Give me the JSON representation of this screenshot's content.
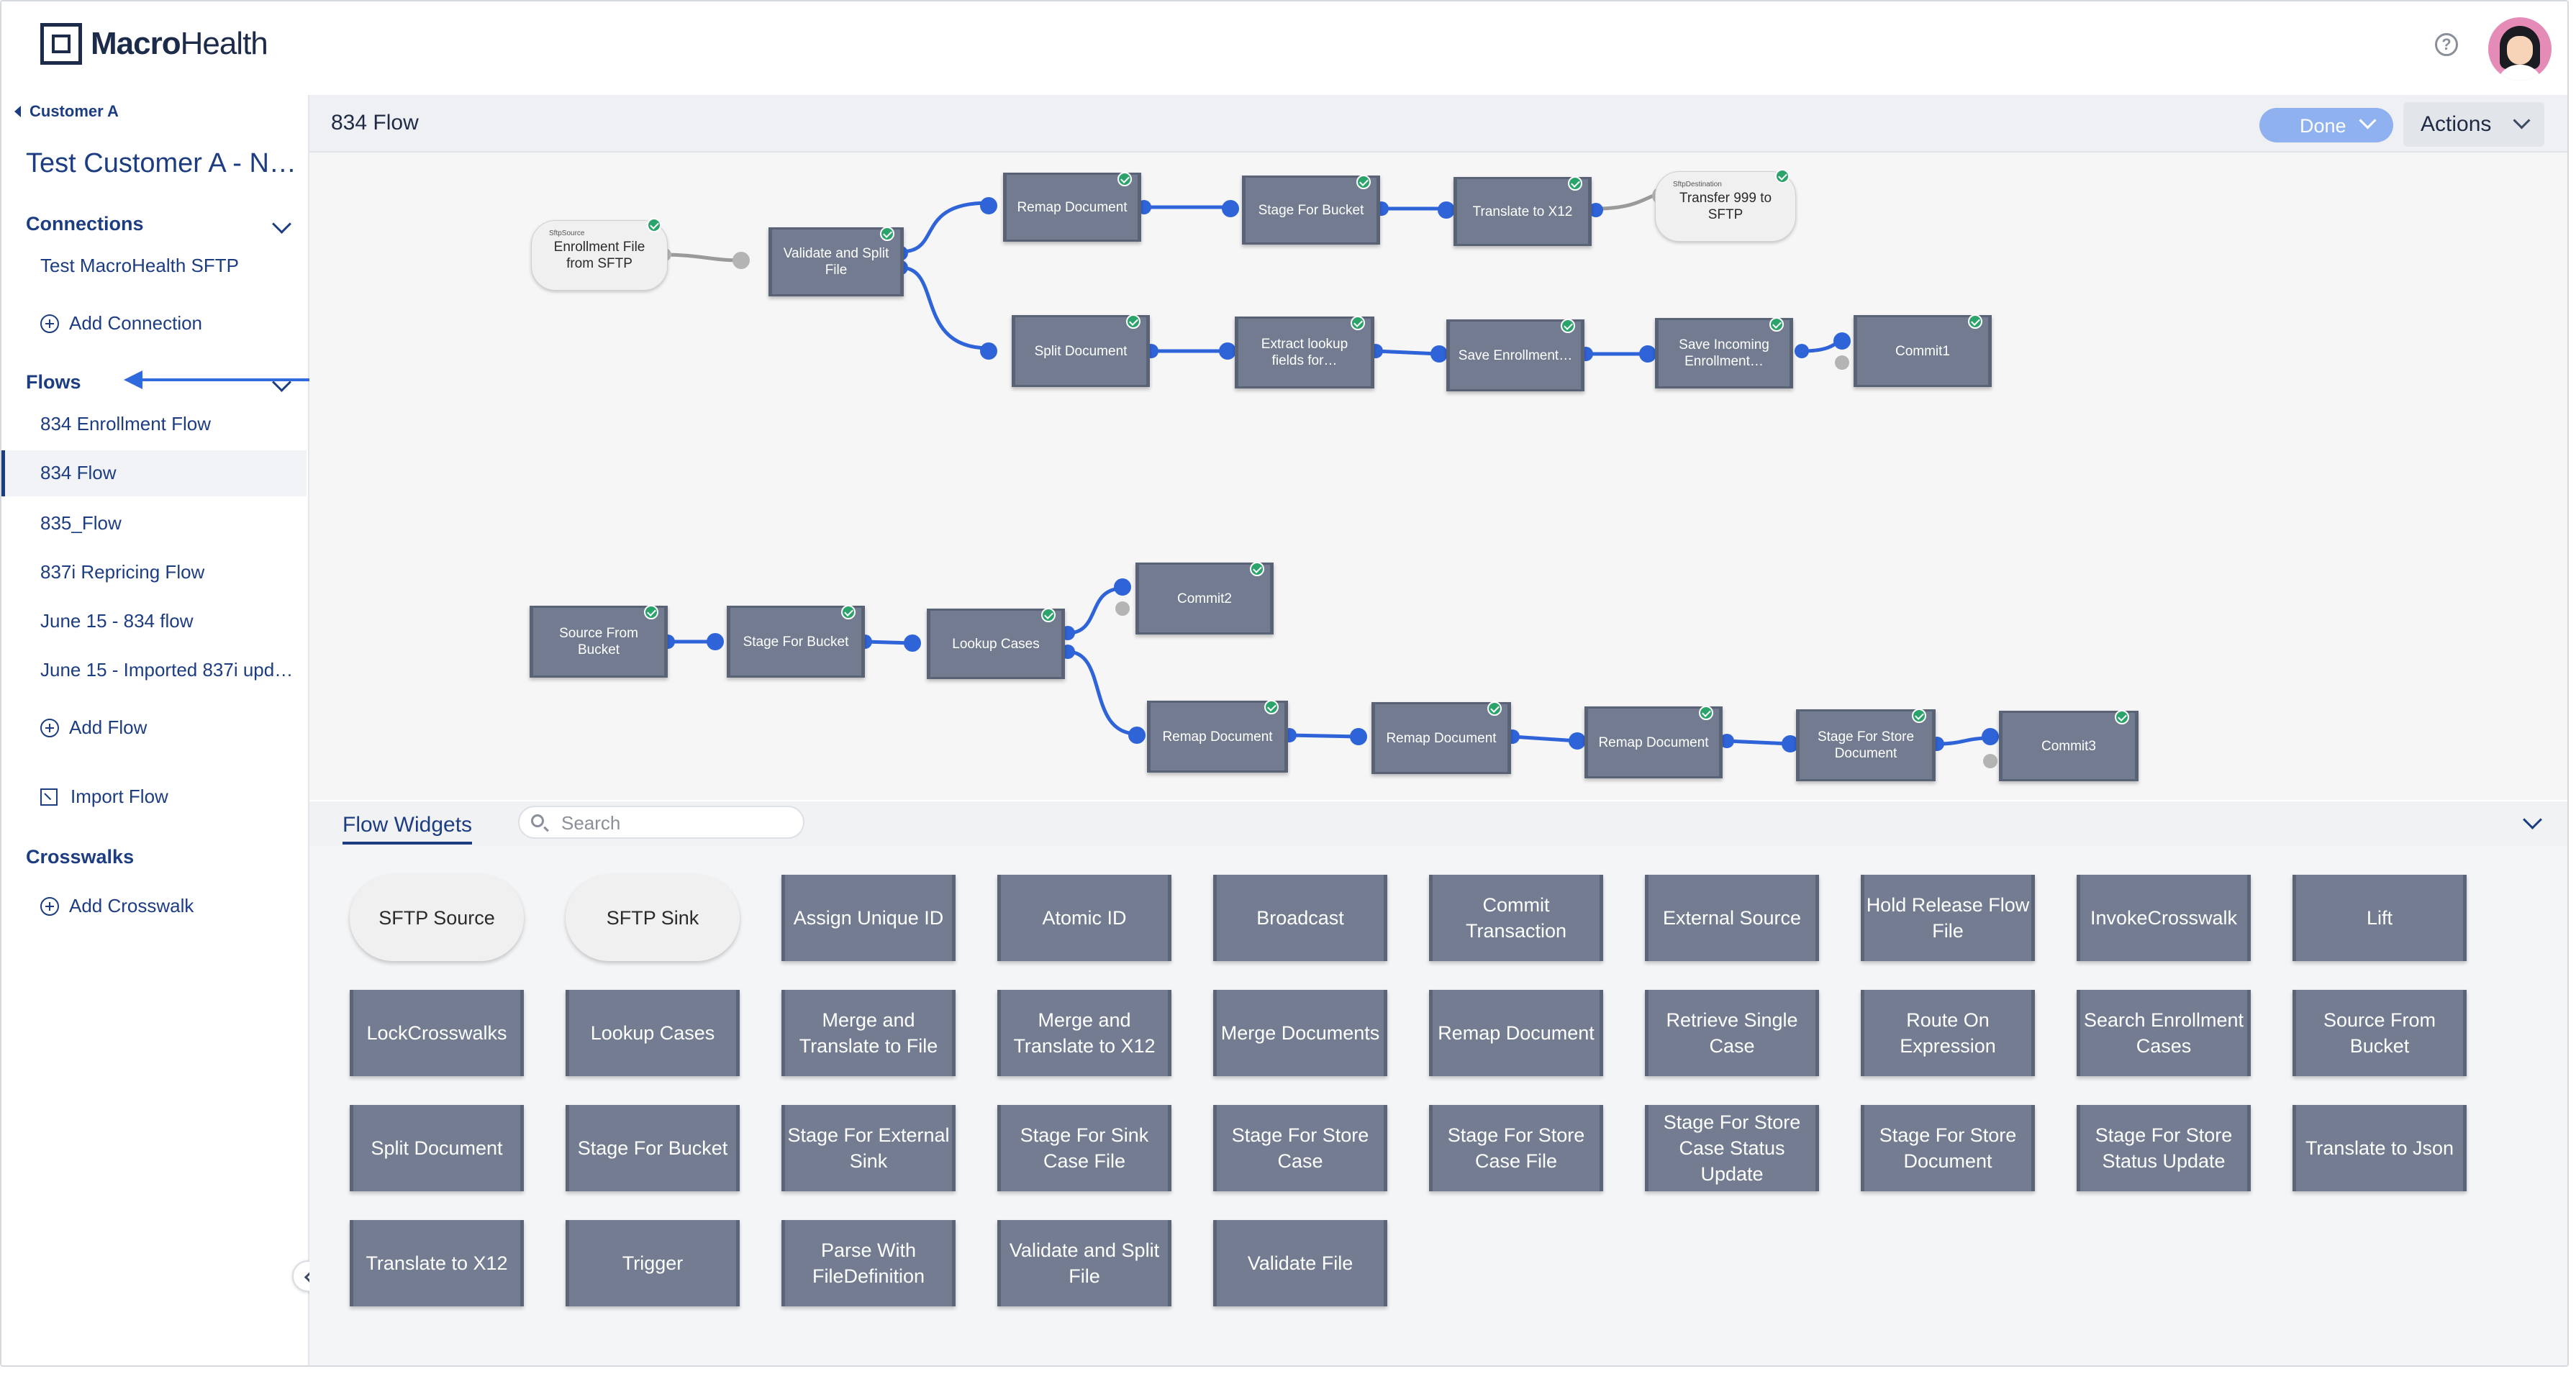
{
  "app": {
    "logo_bold": "Macro",
    "logo_rest": "Health"
  },
  "header": {
    "help_icon": "?"
  },
  "sidebar": {
    "breadcrumb": "Customer A",
    "title": "Test Customer A - N…",
    "connections_label": "Connections",
    "connections": [
      "Test MacroHealth SFTP"
    ],
    "add_connection": "Add Connection",
    "flows_label": "Flows",
    "flows": [
      "834 Enrollment Flow",
      "834 Flow",
      "835_Flow",
      "837i Repricing Flow",
      "June 15 - 834 flow",
      "June 15 - Imported 837i upd…"
    ],
    "active_flow": "834 Flow",
    "add_flow": "Add Flow",
    "import_flow": "Import Flow",
    "crosswalks_label": "Crosswalks",
    "add_crosswalk": "Add Crosswalk"
  },
  "main": {
    "flow_title": "834 Flow",
    "done_label": "Done",
    "actions_label": "Actions"
  },
  "canvas": {
    "nodes": {
      "sftp_source": {
        "sub": "SftpSource",
        "label": "Enrollment File from  SFTP"
      },
      "validate_split": "Validate and Split File",
      "remap1": "Remap Document",
      "stage_bucket1": "Stage For Bucket",
      "translate_x12": "Translate to X12",
      "sftp_dest": {
        "sub": "SftpDestination",
        "label": "Transfer 999 to SFTP"
      },
      "split_doc": "Split Document",
      "extract_lookup": "Extract lookup fields for…",
      "save_enroll": "Save Enrollment…",
      "save_incoming": "Save Incoming Enrollment…",
      "commit1": "Commit1",
      "source_bucket": "Source From Bucket",
      "stage_bucket2": "Stage For Bucket",
      "lookup_cases": "Lookup Cases",
      "commit2": "Commit2",
      "remap2": "Remap Document",
      "remap3": "Remap Document",
      "remap4": "Remap Document",
      "stage_store_doc": "Stage For Store Document",
      "commit3": "Commit3"
    }
  },
  "widgets": {
    "tab_label": "Flow Widgets",
    "search_placeholder": "Search",
    "items": [
      "SFTP Source",
      "SFTP Sink",
      "Assign Unique ID",
      "Atomic ID",
      "Broadcast",
      "Commit Transaction",
      "External Source",
      "Hold Release Flow File",
      "InvokeCrosswalk",
      "Lift",
      "LockCrosswalks",
      "Lookup Cases",
      "Merge and Translate to File",
      "Merge and Translate to X12",
      "Merge Documents",
      "Remap Document",
      "Retrieve Single Case",
      "Route On Expression",
      "Search Enrollment Cases",
      "Source From Bucket",
      "Split Document",
      "Stage For Bucket",
      "Stage For External Sink",
      "Stage For Sink Case File",
      "Stage For Store Case",
      "Stage For Store Case File",
      "Stage For Store Case Status Update",
      "Stage For Store Document",
      "Stage For Store Status Update",
      "Translate to Json",
      "Translate to X12",
      "Trigger",
      "Parse With FileDefinition",
      "Validate and Split File",
      "Validate File"
    ]
  },
  "colors": {
    "accent": "#1d3d82",
    "link_blue": "#2f6bdc",
    "node": "#727b90",
    "done_button": "#8fb1f0"
  }
}
